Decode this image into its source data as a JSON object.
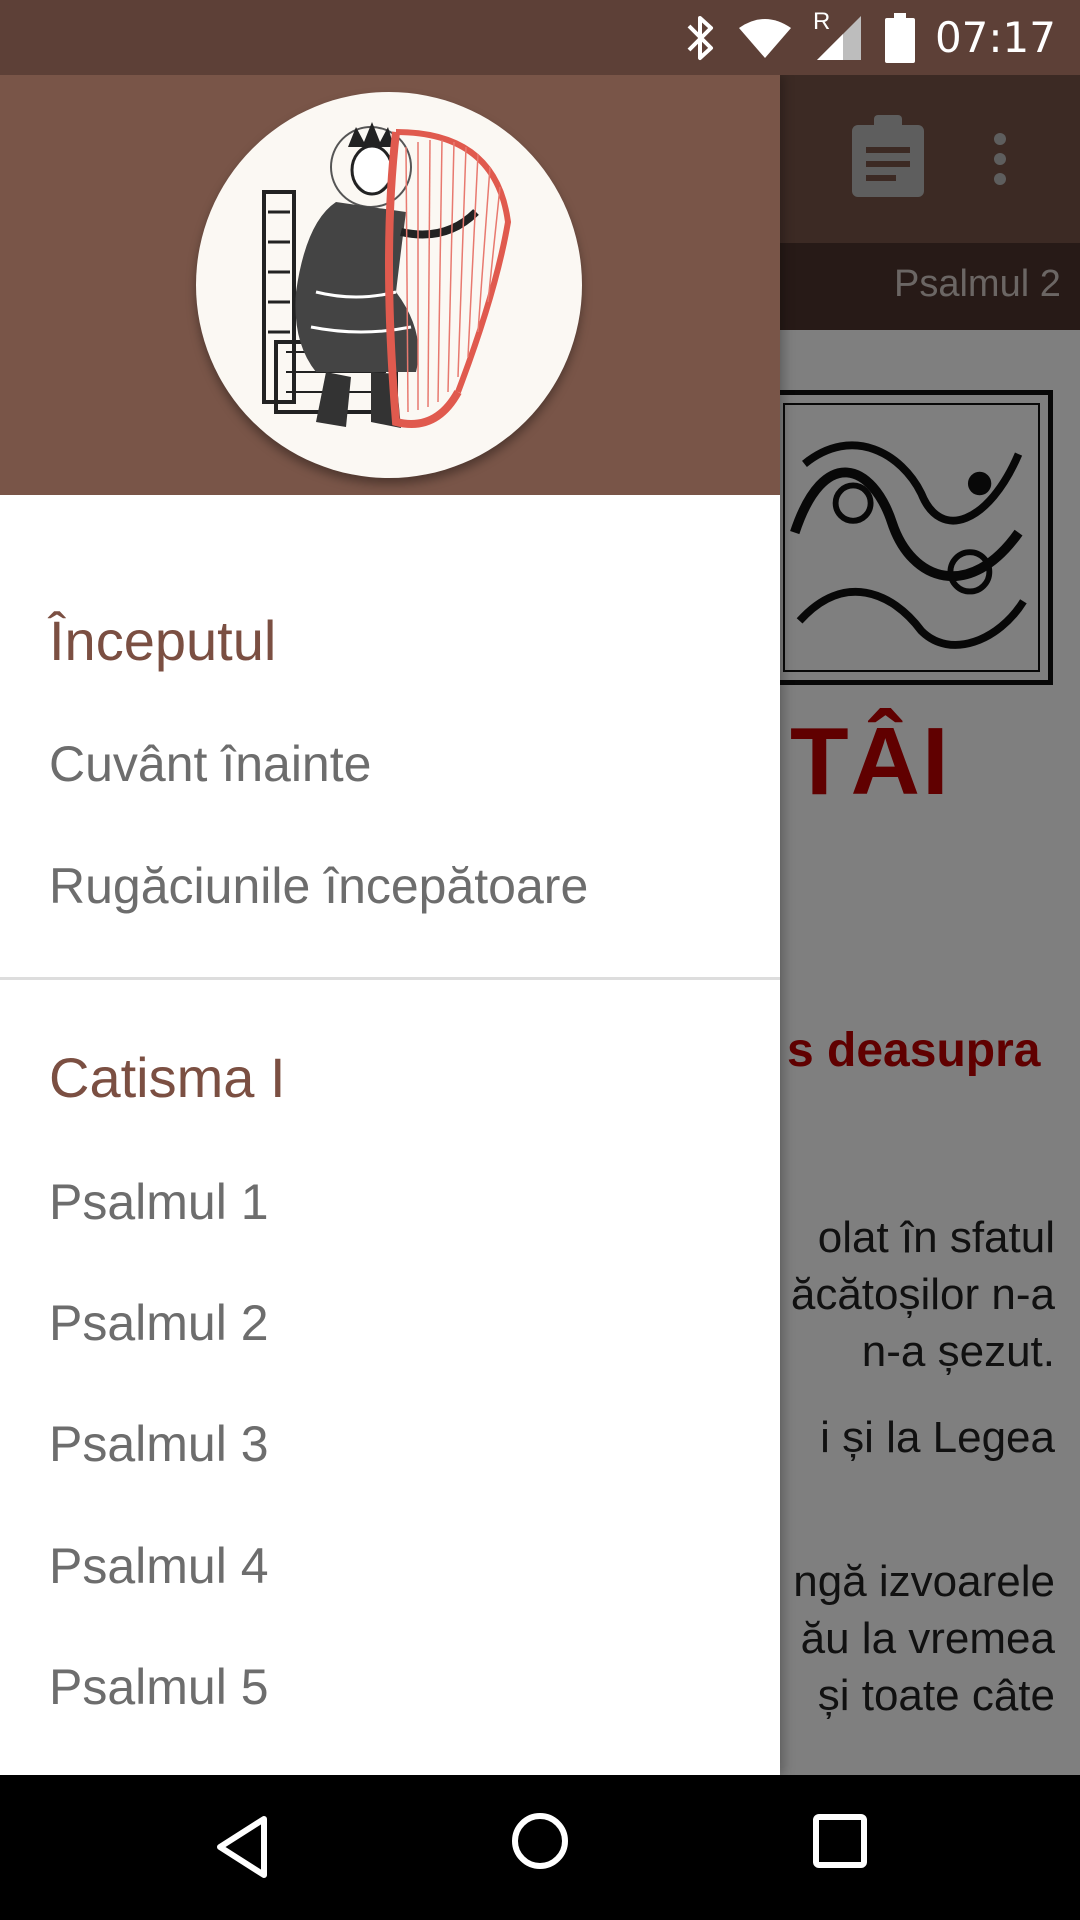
{
  "status_bar": {
    "time": "07:17",
    "network_label": "R",
    "icons": [
      "bluetooth-icon",
      "wifi-icon",
      "cell-signal-icon",
      "battery-icon"
    ],
    "background_color": "#5d4037"
  },
  "background_screen": {
    "tab_label": "Psalmul 2",
    "title_fragment": "TÂI",
    "subtitle_fragment": "s deasupra",
    "text_lines": [
      "olat în sfatul",
      "ăcătoșilor n-a",
      "n-a șezut.",
      "i și la Legea",
      "ngă izvoarele",
      "ău la vremea",
      "și toate câte"
    ],
    "toolbar_icons": [
      "clipboard-icon",
      "more-vert-icon"
    ],
    "toolbar_color": "#795548",
    "title_color": "#c00000"
  },
  "drawer": {
    "sections": [
      {
        "header": "Începutul",
        "items": [
          "Cuvânt înainte",
          "Rugăciunile începătoare"
        ]
      },
      {
        "header": "Catisma I",
        "items": [
          "Psalmul 1",
          "Psalmul 2",
          "Psalmul 3",
          "Psalmul 4",
          "Psalmul 5"
        ]
      }
    ],
    "header_color": "#795548",
    "section_header_color": "#7b4f42"
  },
  "nav_bar": {
    "icons": [
      "back-icon",
      "home-icon",
      "recents-icon"
    ]
  }
}
